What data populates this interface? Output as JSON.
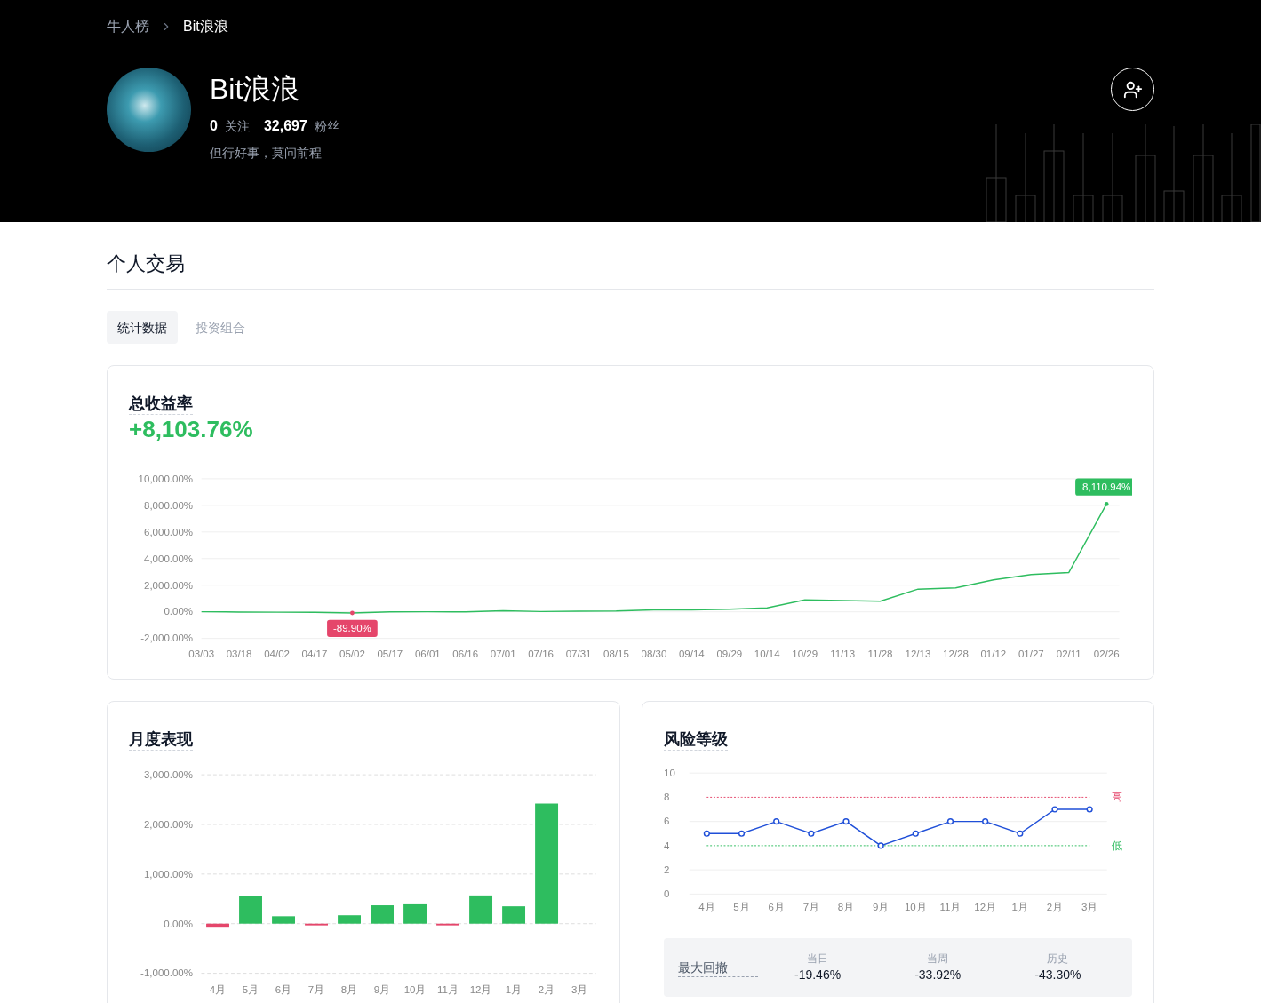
{
  "breadcrumb": [
    {
      "label": "牛人榜"
    },
    {
      "label": "Bit浪浪"
    }
  ],
  "profile": {
    "name": "Bit浪浪",
    "following_count": "0",
    "following_label": "关注",
    "followers_count": "32,697",
    "followers_label": "粉丝",
    "bio": "但行好事，莫问前程"
  },
  "section_title": "个人交易",
  "tabs": [
    {
      "label": "统计数据",
      "selected": true
    },
    {
      "label": "投资组合",
      "selected": false
    }
  ],
  "total_return": {
    "title": "总收益率",
    "value": "+8,103.76%",
    "chart_data": {
      "type": "line",
      "grid": true,
      "x": [
        "03/03",
        "03/18",
        "04/02",
        "04/17",
        "05/02",
        "05/17",
        "06/01",
        "06/16",
        "07/01",
        "07/16",
        "07/31",
        "08/15",
        "08/30",
        "09/14",
        "09/29",
        "10/14",
        "10/29",
        "11/13",
        "11/28",
        "12/13",
        "12/28",
        "01/12",
        "01/27",
        "02/11",
        "02/26"
      ],
      "series": [
        {
          "color": "#2ebd5f",
          "values": [
            0,
            -20,
            -30,
            -40,
            -90,
            -10,
            0,
            -10,
            80,
            20,
            50,
            60,
            150,
            150,
            200,
            300,
            900,
            850,
            800,
            1700,
            1800,
            2400,
            2800,
            2950,
            8100
          ]
        }
      ],
      "ylim": [
        -2000,
        10000
      ],
      "yticks": [
        {
          "value": 10000,
          "label": "10,000.00%"
        },
        {
          "value": 8000,
          "label": "8,000.00%"
        },
        {
          "value": 6000,
          "label": "6,000.00%"
        },
        {
          "value": 4000,
          "label": "4,000.00%"
        },
        {
          "value": 2000,
          "label": "2,000.00%"
        },
        {
          "value": 0,
          "label": "0.00%"
        },
        {
          "value": -2000,
          "label": "-2,000.00%"
        }
      ],
      "annotations": [
        {
          "x": "05/02",
          "y": -90,
          "text": "-89.90%"
        },
        {
          "x": "02/26",
          "y": 8100,
          "text": "8,110.94%"
        }
      ]
    }
  },
  "monthly": {
    "title": "月度表现",
    "chart_data": {
      "type": "bar",
      "grid": true,
      "stacked": true,
      "categories": [
        "4月",
        "5月",
        "6月",
        "7月",
        "8月",
        "9月",
        "10月",
        "11月",
        "12月",
        "1月",
        "2月",
        "3月"
      ],
      "series": [
        {
          "color": "#2ebd5f",
          "values": [
            null,
            560,
            150,
            null,
            170,
            370,
            390,
            null,
            570,
            350,
            2420,
            null
          ]
        },
        {
          "color": "#e5466b",
          "values": [
            -80,
            null,
            null,
            -20,
            null,
            null,
            null,
            -10,
            null,
            null,
            null,
            null
          ]
        }
      ],
      "ylim": [
        -1000,
        3000
      ],
      "yticks": [
        {
          "value": 3000,
          "label": "3,000.00%"
        },
        {
          "value": 2000,
          "label": "2,000.00%"
        },
        {
          "value": 1000,
          "label": "1,000.00%"
        },
        {
          "value": 0,
          "label": "0.00%"
        },
        {
          "value": -1000,
          "label": "-1,000.00%"
        }
      ]
    }
  },
  "risk": {
    "title": "风险等级",
    "chart_data": {
      "type": "line",
      "grid": true,
      "categories": [
        "4月",
        "5月",
        "6月",
        "7月",
        "8月",
        "9月",
        "10月",
        "11月",
        "12月",
        "1月",
        "2月",
        "3月"
      ],
      "series": [
        {
          "name": "高",
          "color": "#e5466b",
          "line_style": "dashed",
          "values": [
            8,
            8,
            8,
            8,
            8,
            8,
            8,
            8,
            8,
            8,
            8,
            8
          ]
        },
        {
          "name": "低",
          "color": "#2ebd5f",
          "line_style": "dashed",
          "values": [
            4,
            4,
            4,
            4,
            4,
            4,
            4,
            4,
            4,
            4,
            4,
            4
          ]
        },
        {
          "color": "#1f4fd8",
          "marker": "o",
          "values": [
            5,
            5,
            6,
            5,
            6,
            4,
            5,
            6,
            6,
            5,
            7,
            7
          ]
        }
      ],
      "ylim": [
        0,
        10
      ],
      "yticks": [
        0,
        2,
        4,
        6,
        8,
        10
      ]
    },
    "drawdown": {
      "label": "最大回撤",
      "items": [
        {
          "label": "当日",
          "value": "-19.46%"
        },
        {
          "label": "当周",
          "value": "-33.92%"
        },
        {
          "label": "历史",
          "value": "-43.30%"
        }
      ]
    }
  }
}
